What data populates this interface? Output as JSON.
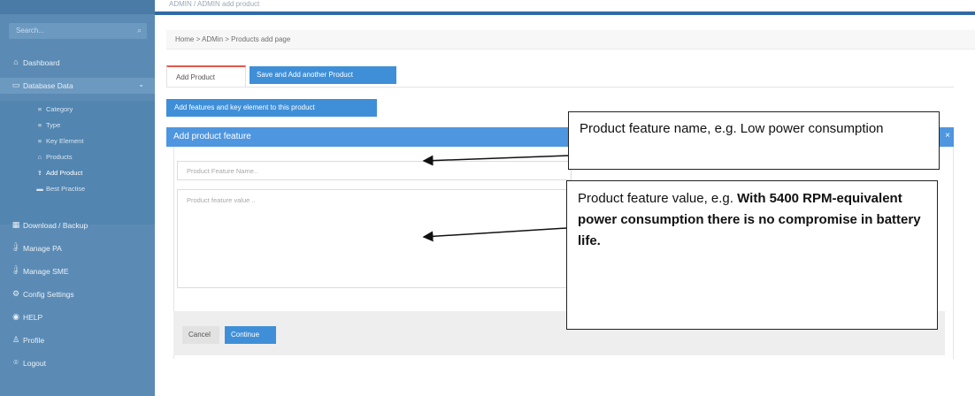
{
  "top": {
    "breadcrumb_faint": "ADMIN / ADMIN add product"
  },
  "sidebar": {
    "search_placeholder": "Search...",
    "items": [
      {
        "label": "Dashboard",
        "icon": "home-icon"
      },
      {
        "label": "Database Data",
        "icon": "database-icon"
      },
      {
        "label": "Download / Backup",
        "icon": "download-icon"
      },
      {
        "label": "Manage PA",
        "icon": "users-icon"
      },
      {
        "label": "Manage SME",
        "icon": "users-icon"
      },
      {
        "label": "Config Settings",
        "icon": "gear-icon"
      },
      {
        "label": "HELP",
        "icon": "help-icon"
      },
      {
        "label": "Profile",
        "icon": "user-icon"
      },
      {
        "label": "Logout",
        "icon": "lock-icon"
      }
    ],
    "subitems": [
      {
        "label": "Category"
      },
      {
        "label": "Type"
      },
      {
        "label": "Key Element"
      },
      {
        "label": "Products"
      },
      {
        "label": "Add Product"
      },
      {
        "label": "Best Practise"
      }
    ]
  },
  "breadcrumb": "Home > ADMin > Products add page",
  "tabs": {
    "add_product": "Add Product",
    "save_another": "Save and Add another Product"
  },
  "add_features_button": "Add features and key element to this product",
  "panel": {
    "title": "Add product feature",
    "name_placeholder": "Product Feature Name..",
    "value_placeholder": "Product feature value .."
  },
  "actions": {
    "cancel": "Cancel",
    "continue": "Continue"
  },
  "callouts": {
    "name": "Product feature name, e.g. Low power consumption",
    "value_prefix": "Product feature value, e.g. ",
    "value_bold": "With 5400 RPM-equivalent power consumption there is no compromise in battery life."
  }
}
